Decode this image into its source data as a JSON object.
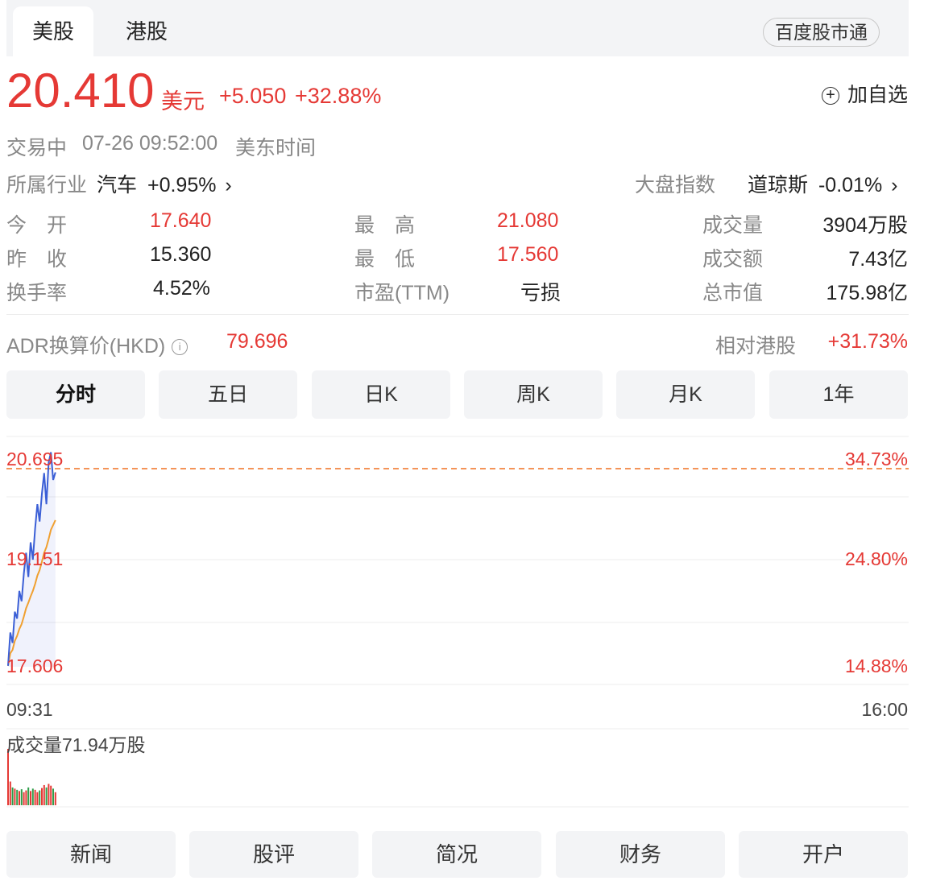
{
  "market_tabs": [
    {
      "label": "美股",
      "active": true
    },
    {
      "label": "港股",
      "active": false
    }
  ],
  "link_pill": "百度股市通",
  "quote": {
    "price": "20.410",
    "currency": "美元",
    "change": "+5.050",
    "change_pct": "+32.88%",
    "add_watch": "加自选"
  },
  "status": {
    "state": "交易中",
    "time": "07-26 09:52:00",
    "timezone": "美东时间"
  },
  "industry": {
    "label": "所属行业",
    "name": "汽车",
    "change": "+0.95%"
  },
  "index": {
    "label": "大盘指数",
    "name": "道琼斯",
    "change": "-0.01%"
  },
  "stats": {
    "open": {
      "label": "今　开",
      "value": "17.640"
    },
    "prev": {
      "label": "昨　收",
      "value": "15.360"
    },
    "turnover_rate": {
      "label": "换手率",
      "value": "4.52%"
    },
    "high": {
      "label": "最　高",
      "value": "21.080"
    },
    "low": {
      "label": "最　低",
      "value": "17.560"
    },
    "pe": {
      "label": "市盈(TTM)",
      "value": "亏损"
    },
    "volume": {
      "label": "成交量",
      "value": "3904万股"
    },
    "amount": {
      "label": "成交额",
      "value": "7.43亿"
    },
    "market_cap": {
      "label": "总市值",
      "value": "175.98亿"
    }
  },
  "adr": {
    "label": "ADR换算价(HKD)",
    "value": "79.696",
    "rel_label": "相对港股",
    "rel_value": "+31.73%"
  },
  "period_tabs": [
    "分时",
    "五日",
    "日K",
    "周K",
    "月K",
    "1年"
  ],
  "active_period": "分时",
  "chart": {
    "y_labels": [
      "20.695",
      "19.151",
      "17.606"
    ],
    "pct_labels": [
      "34.73%",
      "24.80%",
      "14.88%"
    ],
    "x_start": "09:31",
    "x_end": "16:00",
    "volume_label": "成交量71.94万股",
    "colors": {
      "price": "#3b5fd6",
      "avg": "#f0a030",
      "up": "#e53935",
      "down": "#2e9e4a",
      "ref": "#f07020"
    }
  },
  "chart_data": {
    "type": "line",
    "x": [
      "09:31",
      "09:32",
      "09:33",
      "09:34",
      "09:35",
      "09:36",
      "09:37",
      "09:38",
      "09:39",
      "09:40",
      "09:41",
      "09:42",
      "09:43",
      "09:44",
      "09:45",
      "09:46",
      "09:47",
      "09:48",
      "09:49",
      "09:50",
      "09:51",
      "09:52"
    ],
    "series": [
      {
        "values": [
          17.62,
          18.1,
          17.95,
          18.4,
          18.3,
          18.7,
          18.55,
          18.95,
          19.25,
          18.9,
          19.4,
          19.15,
          19.6,
          19.95,
          19.7,
          20.1,
          20.4,
          19.95,
          20.55,
          20.7,
          20.3,
          20.41
        ]
      },
      {
        "values": [
          17.62,
          17.8,
          17.85,
          17.98,
          18.05,
          18.15,
          18.22,
          18.33,
          18.45,
          18.53,
          18.62,
          18.7,
          18.8,
          18.92,
          19.0,
          19.12,
          19.25,
          19.33,
          19.45,
          19.58,
          19.65,
          19.72
        ]
      }
    ],
    "volume": [
      95,
      40,
      30,
      28,
      26,
      24,
      27,
      22,
      25,
      30,
      24,
      28,
      26,
      22,
      25,
      29,
      34,
      30,
      36,
      33,
      28,
      22
    ],
    "volume_up": [
      true,
      true,
      false,
      true,
      false,
      true,
      false,
      true,
      true,
      false,
      true,
      false,
      true,
      true,
      false,
      true,
      true,
      false,
      true,
      true,
      false,
      true
    ],
    "ylim": [
      17.606,
      20.695
    ]
  }
}
